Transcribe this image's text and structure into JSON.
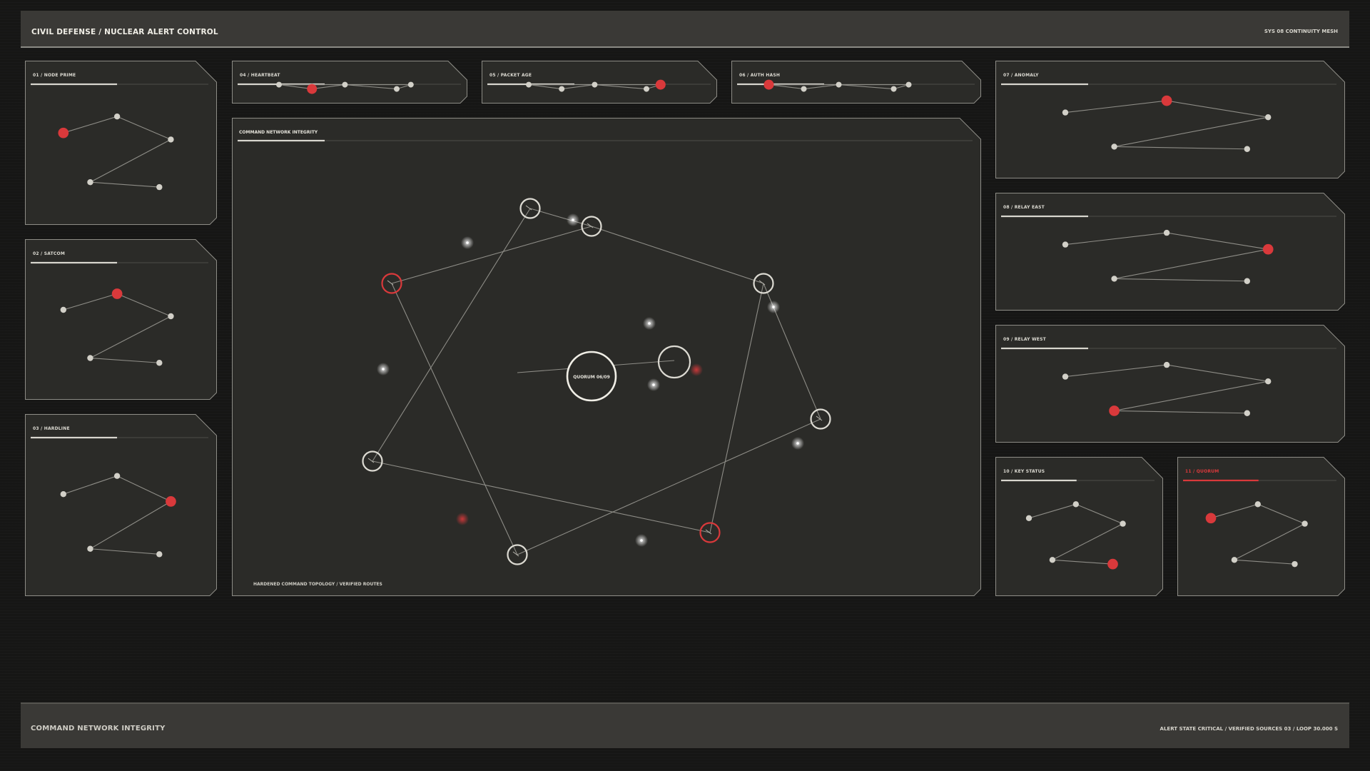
{
  "header": {
    "title": "CIVIL DEFENSE / NUCLEAR ALERT CONTROL",
    "right_text": "SYS 08  CONTINUITY MESH"
  },
  "footer": {
    "title": "COMMAND NETWORK INTEGRITY",
    "status_text": "ALERT STATE  CRITICAL / VERIFIED SOURCES 03 / LOOP 30.000 S"
  },
  "colors": {
    "background": "#161615",
    "panel": "#2b2b28",
    "panel_border": "#8d8c86",
    "node": "#d2d0c8",
    "alert": "#d9393b",
    "edge": "#8e8d87"
  },
  "panels": [
    {
      "id": "p01",
      "title": "01 / NODE PRIME",
      "alert_node": 0,
      "alert_title": false
    },
    {
      "id": "p02",
      "title": "02 / SATCOM",
      "alert_node": 1,
      "alert_title": false
    },
    {
      "id": "p03",
      "title": "03 / HARDLINE",
      "alert_node": 2,
      "alert_title": false
    },
    {
      "id": "p04",
      "title": "04 / HEARTBEAT",
      "alert_node": 1,
      "alert_title": false
    },
    {
      "id": "p05",
      "title": "05 / PACKET AGE",
      "alert_node": 4,
      "alert_title": false
    },
    {
      "id": "p06",
      "title": "06 / AUTH HASH",
      "alert_node": 0,
      "alert_title": false
    },
    {
      "id": "p07",
      "title": "07 / ANOMALY",
      "alert_node": 1,
      "alert_title": false
    },
    {
      "id": "p08",
      "title": "08 / RELAY EAST",
      "alert_node": 2,
      "alert_title": false
    },
    {
      "id": "p09",
      "title": "09 / RELAY WEST",
      "alert_node": 3,
      "alert_title": false
    },
    {
      "id": "p10",
      "title": "10 / KEY STATUS",
      "alert_node": 4,
      "alert_title": false
    },
    {
      "id": "p11",
      "title": "11 / QUORUM",
      "alert_node": 0,
      "alert_title": true
    }
  ],
  "main": {
    "title": "COMMAND NETWORK INTEGRITY",
    "center_label": "QUORUM 06/09",
    "footer_label": "HARDENED COMMAND TOPOLOGY / VERIFIED ROUTES",
    "alert_nodes": [
      1,
      6
    ]
  }
}
